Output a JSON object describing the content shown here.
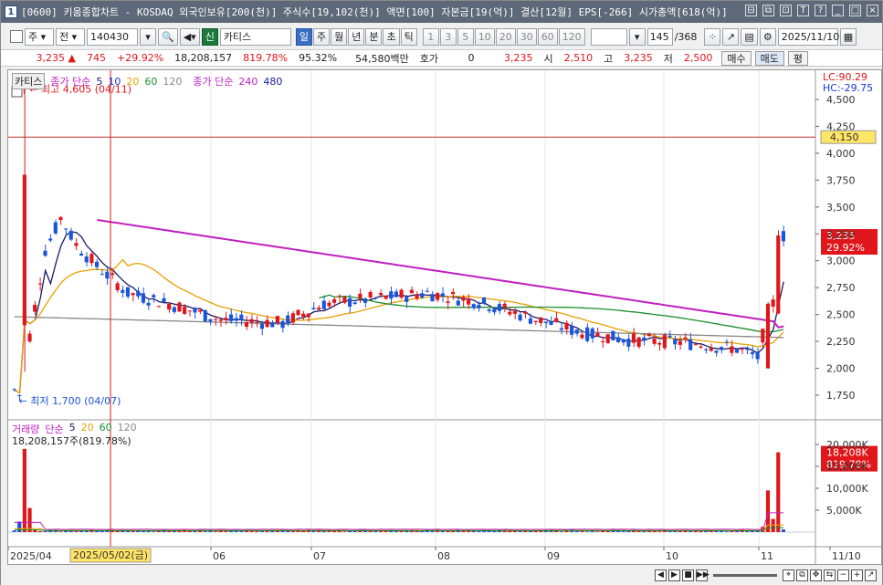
{
  "window": {
    "number": "1",
    "title": "[0600] 키움종합차트 - KOSDAQ 외국인보유[200(천)] 주식수[19,102(천)] 액면[100] 자본금[19(억)] 결산[12월] EPS[-266] 시가총액[618(억)]"
  },
  "toolbar": {
    "period_selector": "주",
    "type_selector": "전",
    "code": "140430",
    "stock_name": "카티스",
    "period_buttons": [
      "일",
      "주",
      "월",
      "년",
      "분",
      "초",
      "틱"
    ],
    "interval_buttons": [
      "1",
      "3",
      "5",
      "10",
      "20",
      "30",
      "60",
      "120"
    ],
    "count": "145",
    "total": "/368",
    "date": "2025/11/10"
  },
  "quote": {
    "price": "3,235",
    "change": "745",
    "change_pct": "+29.92%",
    "volume": "18,208,157",
    "volume_pct": "819.78%",
    "strength": "95.32%",
    "amount": "54,580백만",
    "hoga_label": "호가",
    "hoga_value": "0",
    "current": "3,235",
    "open_label": "시",
    "open": "2,510",
    "high_label": "고",
    "high": "3,235",
    "low_label": "저",
    "low": "2,500",
    "buy_label": "매수",
    "sell_label": "매도",
    "avg_label": "평"
  },
  "chart": {
    "price_panel": {
      "legend_name": "카티스",
      "legend_ma": "종가 단순",
      "legend_periods": [
        "5",
        "10",
        "20",
        "60",
        "120"
      ],
      "legend_ma2": "종가 단순",
      "legend_periods2": [
        "240",
        "480"
      ],
      "lc": "LC:90.29",
      "hc": "HC:-29.75",
      "high_marker": "최고 4,605 (04/11)",
      "low_marker": "최저 1,700 (04/07)",
      "hline_value": "4,150",
      "last_price": "3,235",
      "last_pct": "29.92%",
      "y_ticks": [
        "4,500",
        "4,250",
        "4,000",
        "3,750",
        "3,500",
        "3,250",
        "3,000",
        "2,750",
        "2,500",
        "2,250",
        "2,000",
        "1,750"
      ]
    },
    "volume_panel": {
      "legend_name": "거래량",
      "legend_ma": "단순",
      "legend_periods": [
        "5",
        "20",
        "60",
        "120"
      ],
      "current_text": "18,208,157주(819.78%)",
      "last_value": "18,208K",
      "last_pct": "819.78%",
      "y_ticks": [
        "20,000K",
        "15,000K",
        "10,000K",
        "5,000K"
      ]
    },
    "x_axis": {
      "labels": [
        "2025/04",
        "06",
        "07",
        "08",
        "09",
        "10",
        "11",
        "11/10"
      ],
      "cursor_label": "2025/05/02(금)"
    },
    "colors": {
      "up": "#e0161a",
      "down": "#1b55d9",
      "ma5": "#1a1a66",
      "ma20": "#e8a000",
      "ma60": "#1b8f2a",
      "ma120": "#888888",
      "ma240": "#c020c0",
      "cursor": "#d02020"
    }
  }
}
